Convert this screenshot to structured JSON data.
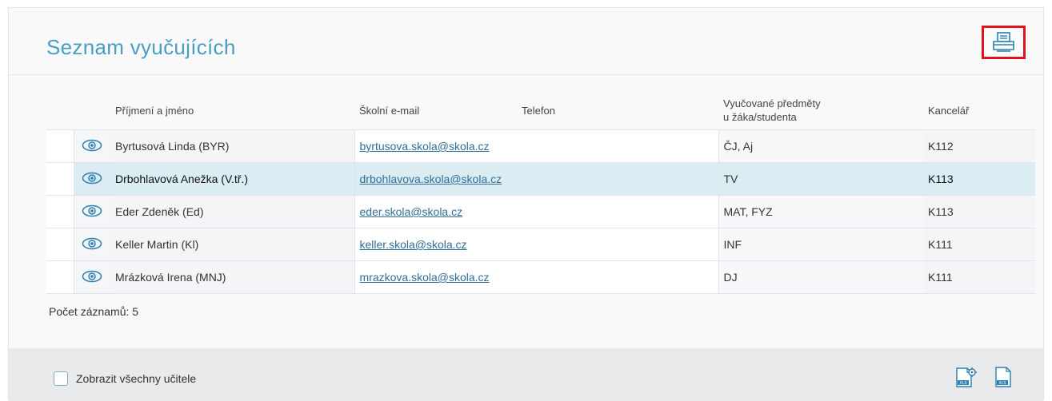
{
  "page": {
    "title": "Seznam vyučujících",
    "print_icon": "printer-icon"
  },
  "table": {
    "columns": {
      "name": "Příjmení a jméno",
      "email": "Školní e-mail",
      "phone": "Telefon",
      "subjects_line1": "Vyučované předměty",
      "subjects_line2": "u žáka/studenta",
      "office": "Kancelář"
    },
    "row_icon": "eye-icon",
    "rows": [
      {
        "name": "Byrtusová Linda (BYR)",
        "email": "byrtusova.skola@skola.cz",
        "phone": "",
        "subjects": "ČJ, Aj",
        "office": "K112",
        "selected": false
      },
      {
        "name": "Drbohlavová Anežka (V.tř.)",
        "email": "drbohlavova.skola@skola.cz",
        "phone": "",
        "subjects": "TV",
        "office": "K113",
        "selected": true
      },
      {
        "name": "Eder Zdeněk (Ed)",
        "email": "eder.skola@skola.cz",
        "phone": "",
        "subjects": "MAT, FYZ",
        "office": "K113",
        "selected": false
      },
      {
        "name": "Keller Martin (Kl)",
        "email": "keller.skola@skola.cz",
        "phone": "",
        "subjects": "INF",
        "office": "K111",
        "selected": false
      },
      {
        "name": "Mrázková Irena (MNJ)",
        "email": "mrazkova.skola@skola.cz",
        "phone": "",
        "subjects": "DJ",
        "office": "K111",
        "selected": false
      }
    ]
  },
  "record_count": "Počet záznamů: 5",
  "footer": {
    "checkbox_label": "Zobrazit všechny učitele",
    "checkbox_checked": false,
    "export_icons": [
      "xls-settings-icon",
      "xls-export-icon"
    ]
  },
  "colors": {
    "title": "#4a9ec3",
    "highlight_border": "#e0121b",
    "selected_row": "#dcecf3",
    "link": "#2f6f97"
  }
}
